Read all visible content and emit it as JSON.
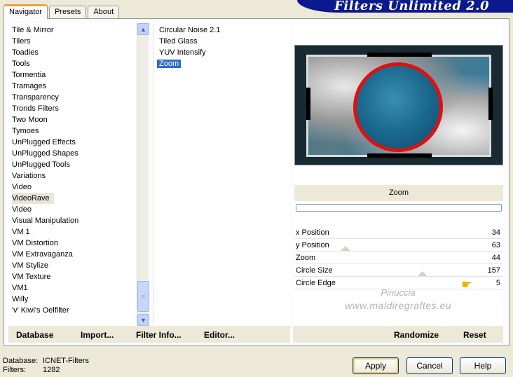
{
  "tabs": [
    {
      "label": "Navigator",
      "active": true
    },
    {
      "label": "Presets",
      "active": false
    },
    {
      "label": "About",
      "active": false
    }
  ],
  "banner": {
    "title": "Filters Unlimited 2.0"
  },
  "categories": [
    "Tile & Mirror",
    "Tilers",
    "Toadies",
    "Tools",
    "Tormentia",
    "Tramages",
    "Transparency",
    "Tronds Filters",
    "Two Moon",
    "Tymoes",
    "UnPlugged Effects",
    "UnPlugged Shapes",
    "UnPlugged Tools",
    "Variations",
    "Video",
    "VideoRave",
    "Video",
    "Visual Manipulation",
    "VM 1",
    "VM Distortion",
    "VM Extravaganza",
    "VM Stylize",
    "VM Texture",
    "VM1",
    "Willy",
    "'v' Kiwi's Oelfilter"
  ],
  "selected_category_index": 15,
  "filters": [
    "Circular Noise 2.1",
    "Tiled Glass",
    "YUV Intensify",
    "Zoom"
  ],
  "selected_filter_index": 3,
  "filter_title": "Zoom",
  "params": [
    {
      "name": "x Position",
      "value": "34"
    },
    {
      "name": "y Position",
      "value": "63"
    },
    {
      "name": "Zoom",
      "value": "44"
    },
    {
      "name": "Circle Size",
      "value": "157"
    },
    {
      "name": "Circle Edge",
      "value": "5"
    }
  ],
  "watermark": {
    "line1": "Pinuccia",
    "line2": "www.maldiregraftes.eu"
  },
  "toolbar_left": {
    "database": "Database",
    "import": "Import...",
    "filter_info": "Filter Info...",
    "editor": "Editor..."
  },
  "toolbar_right": {
    "randomize": "Randomize",
    "reset": "Reset"
  },
  "status": {
    "database_label": "Database:",
    "database_value": "ICNET-Filters",
    "filters_label": "Filters:",
    "filters_value": "1282"
  },
  "buttons": {
    "apply": "Apply",
    "cancel": "Cancel",
    "help": "Help"
  },
  "colors": {
    "banner": "#0a1a8c",
    "selection": "#316ac5",
    "circle": "#e01010"
  }
}
